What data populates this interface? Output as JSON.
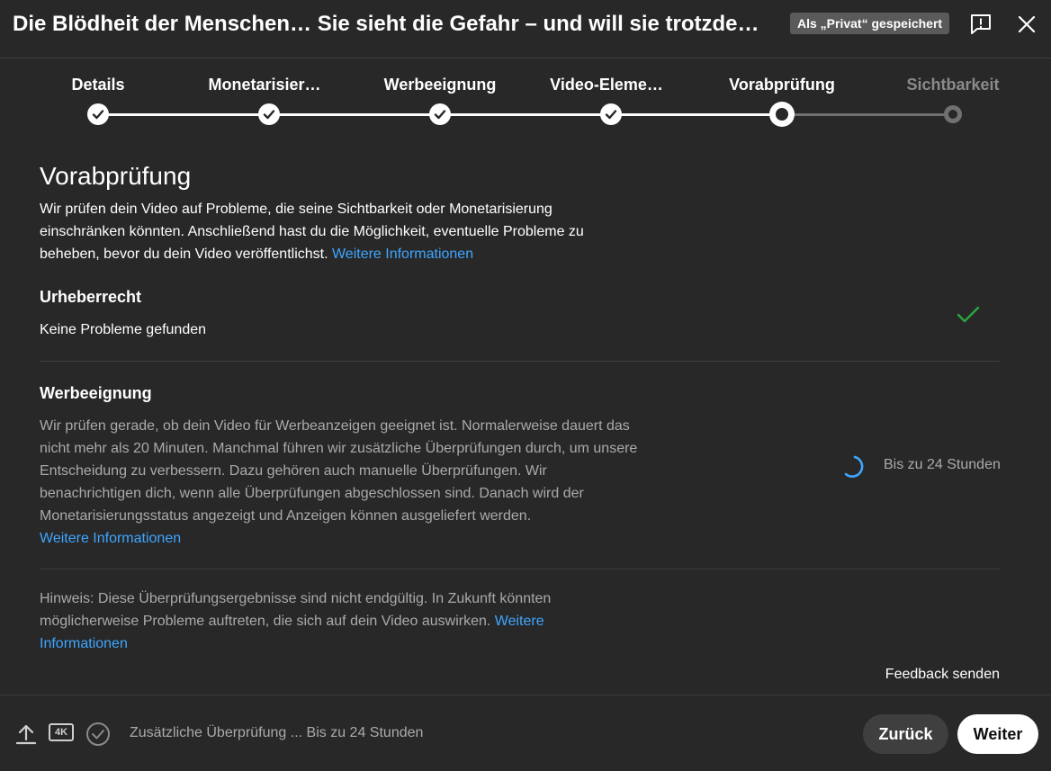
{
  "header": {
    "title": "Die Blödheit der Menschen… Sie sieht die Gefahr – und will sie trotzdem nicht sehen",
    "saved_badge": "Als „Privat“ gespeichert",
    "feedback_icon": "report-feedback-icon",
    "close_icon": "close-icon"
  },
  "stepper": {
    "steps": [
      {
        "label": "Details",
        "state": "done"
      },
      {
        "label": "Monetarisier…",
        "state": "done"
      },
      {
        "label": "Werbeeignung",
        "state": "done"
      },
      {
        "label": "Video-Eleme…",
        "state": "done"
      },
      {
        "label": "Vorabprüfung",
        "state": "current"
      },
      {
        "label": "Sichtbarkeit",
        "state": "pending"
      }
    ]
  },
  "page": {
    "heading": "Vorabprüfung",
    "intro": "Wir prüfen dein Video auf Probleme, die seine Sichtbarkeit oder Monetarisierung einschränken könnten. Anschließend hast du die Möglichkeit, eventuelle Probleme zu beheben, bevor du dein Video veröffentlichst.",
    "intro_link": "Weitere Informationen"
  },
  "copyright": {
    "title": "Urheberrecht",
    "status": "Keine Probleme gefunden"
  },
  "ad_suitability": {
    "title": "Werbeeignung",
    "body": "Wir prüfen gerade, ob dein Video für Werbeanzeigen geeignet ist. Normalerweise dauert das nicht mehr als 20 Minuten. Manchmal führen wir zusätzliche Überprüfungen durch, um unsere Entscheidung zu verbessern. Dazu gehören auch manuelle Überprüfungen. Wir benachrichtigen dich, wenn alle Überprüfungen abgeschlossen sind. Danach wird der Monetarisierungsstatus angezeigt und Anzeigen können ausgeliefert werden.",
    "link": "Weitere Informationen",
    "status": "Bis zu 24 Stunden"
  },
  "note": {
    "text": "Hinweis: Diese Überprüfungsergebnisse sind nicht endgültig. In Zukunft könnten möglicherweise Probleme auftreten, die sich auf dein Video auswirken.",
    "link": "Weitere Informationen",
    "feedback": "Feedback senden"
  },
  "footer": {
    "status": "Zusätzliche Überprüfung ... Bis zu 24 Stunden",
    "back": "Zurück",
    "next": "Weiter",
    "quality_badge": "4K"
  },
  "colors": {
    "background": "#282828",
    "link": "#3ea6ff",
    "check": "#2ba640",
    "spinner": "#3ea6ff"
  }
}
